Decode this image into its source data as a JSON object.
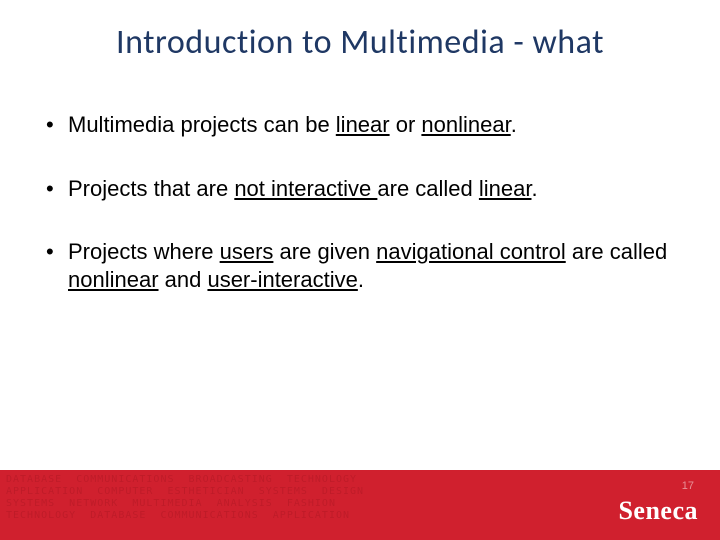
{
  "title": "Introduction to Multimedia - what",
  "bullets": [
    {
      "segments": [
        {
          "t": "Multimedia projects can be "
        },
        {
          "t": "linear",
          "u": true
        },
        {
          "t": " or "
        },
        {
          "t": "nonlinear",
          "u": true
        },
        {
          "t": "."
        }
      ]
    },
    {
      "segments": [
        {
          "t": "Projects that are "
        },
        {
          "t": "not interactive ",
          "u": true
        },
        {
          "t": "are called "
        },
        {
          "t": "linear",
          "u": true
        },
        {
          "t": "."
        }
      ]
    },
    {
      "segments": [
        {
          "t": "Projects where "
        },
        {
          "t": "users",
          "u": true
        },
        {
          "t": " are given "
        },
        {
          "t": "navigational control",
          "u": true
        },
        {
          "t": " are called "
        },
        {
          "t": "nonlinear",
          "u": true
        },
        {
          "t": " and "
        },
        {
          "t": "user-interactive",
          "u": true
        },
        {
          "t": "."
        }
      ]
    }
  ],
  "footer": {
    "logo": "Seneca",
    "page_number": "17",
    "texture": "DATABASE  COMMUNICATIONS  BROADCASTING  TECHNOLOGY\nAPPLICATION  COMPUTER  ESTHETICIAN  SYSTEMS  DESIGN\nSYSTEMS  NETWORK  MULTIMEDIA  ANALYSIS  FASHION\nTECHNOLOGY  DATABASE  COMMUNICATIONS  APPLICATION"
  }
}
